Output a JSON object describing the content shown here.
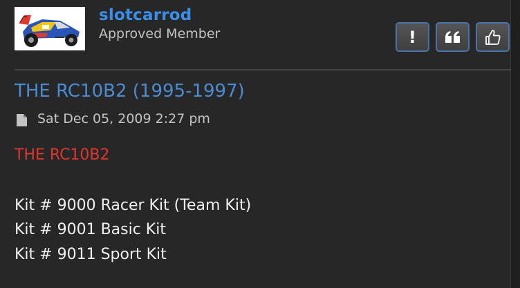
{
  "post": {
    "author": {
      "username": "slotcarrod",
      "rank": "Approved Member"
    },
    "actions": {
      "report_glyph": "!",
      "quote_icon": "quote-icon",
      "like_icon": "thumbs-up-icon"
    },
    "title": "THE RC10B2 (1995-1997)",
    "date": "Sat Dec 05, 2009 2:27 pm",
    "content": {
      "heading": "THE RC10B2",
      "lines": [
        "Kit # 9000 Racer Kit (Team Kit)",
        "Kit # 9001 Basic Kit",
        "Kit # 9011 Sport Kit"
      ]
    }
  },
  "colors": {
    "background": "#272727",
    "username": "#3b8ee8",
    "title": "#4a8bd1",
    "heading_red": "#e0362e",
    "button_border": "#4a73a9"
  }
}
